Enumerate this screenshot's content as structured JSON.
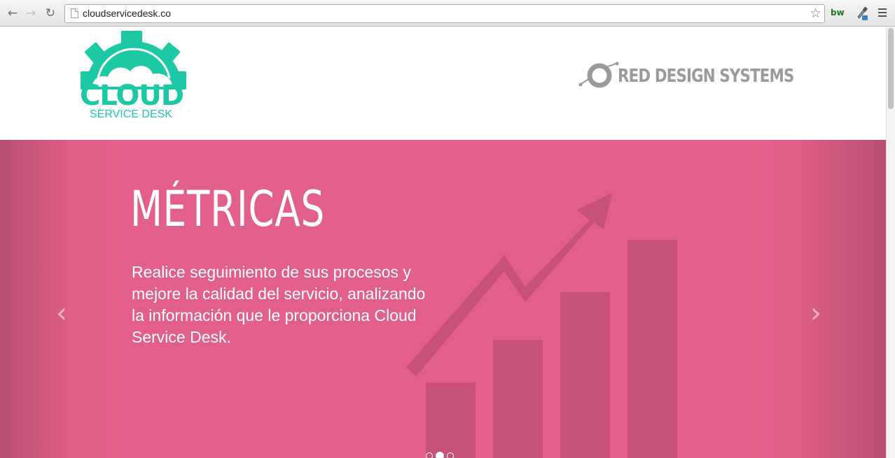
{
  "browser": {
    "url": "cloudservicedesk.co",
    "back_icon": "back-arrow-icon",
    "forward_icon": "forward-arrow-icon",
    "reload_icon": "reload-icon",
    "extension_label": "bw"
  },
  "header": {
    "logo_text": "CLOUD",
    "logo_subtext": "SERVICE DESK",
    "partner_text": "RED DESIGN SYSTEMS",
    "brand_color": "#1dc9a4",
    "partner_color": "#9a9a9a"
  },
  "carousel": {
    "title": "MÉTRICAS",
    "text": "Realice seguimiento de sus procesos y mejore la calidad del servicio, analizando la información que le proporciona Cloud Service Desk.",
    "prev_label": "‹",
    "next_label": "›",
    "indicator_count": 3,
    "active_indicator": 2,
    "background_color": "#e25f89"
  }
}
